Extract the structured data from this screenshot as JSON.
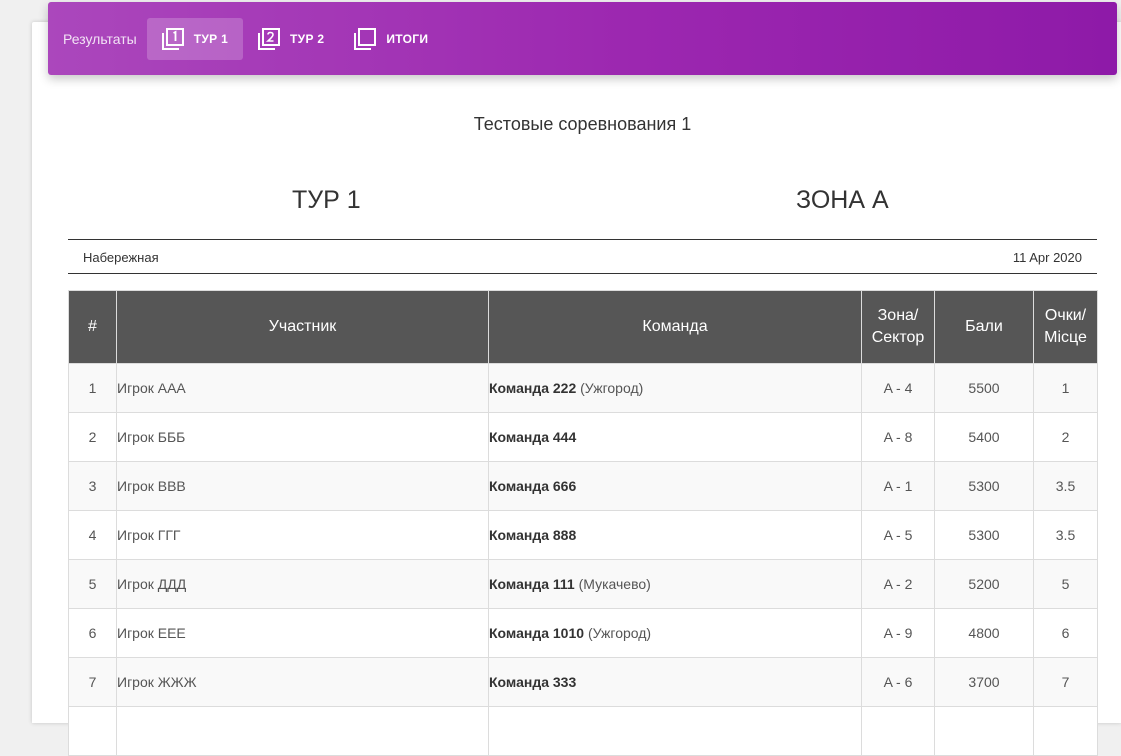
{
  "nav": {
    "brand": "Результаты",
    "tabs": [
      {
        "label": "ТУР 1",
        "icon": "filter-1-icon",
        "active": true
      },
      {
        "label": "ТУР 2",
        "icon": "filter-2-icon",
        "active": false
      },
      {
        "label": "ИТОГИ",
        "icon": "filter-none-icon",
        "active": false
      }
    ]
  },
  "page": {
    "title": "Тестовые соревнования 1",
    "round": "ТУР 1",
    "zone": "ЗОНА А",
    "location": "Набережная",
    "date": "11 Apr 2020"
  },
  "table": {
    "headers": [
      "#",
      "Участник",
      "Команда",
      "Зона/ Сектор",
      "Бали",
      "Очки/ Місце"
    ],
    "rows": [
      {
        "num": "1",
        "player": "Игрок ААА",
        "team": "Команда 222",
        "city": "(Ужгород)",
        "sector": "A - 4",
        "points": "5500",
        "place": "1"
      },
      {
        "num": "2",
        "player": "Игрок БББ",
        "team": "Команда 444",
        "city": "",
        "sector": "A - 8",
        "points": "5400",
        "place": "2"
      },
      {
        "num": "3",
        "player": "Игрок ВВВ",
        "team": "Команда 666",
        "city": "",
        "sector": "A - 1",
        "points": "5300",
        "place": "3.5"
      },
      {
        "num": "4",
        "player": "Игрок ГГГ",
        "team": "Команда 888",
        "city": "",
        "sector": "A - 5",
        "points": "5300",
        "place": "3.5"
      },
      {
        "num": "5",
        "player": "Игрок ДДД",
        "team": "Команда 111",
        "city": "(Мукачево)",
        "sector": "A - 2",
        "points": "5200",
        "place": "5"
      },
      {
        "num": "6",
        "player": "Игрок ЕЕЕ",
        "team": "Команда 1010",
        "city": "(Ужгород)",
        "sector": "A - 9",
        "points": "4800",
        "place": "6"
      },
      {
        "num": "7",
        "player": "Игрок ЖЖЖ",
        "team": "Команда 333",
        "city": "",
        "sector": "A - 6",
        "points": "3700",
        "place": "7"
      }
    ]
  },
  "colors": {
    "accent": "#9c27b0",
    "header_bg": "#565656"
  }
}
